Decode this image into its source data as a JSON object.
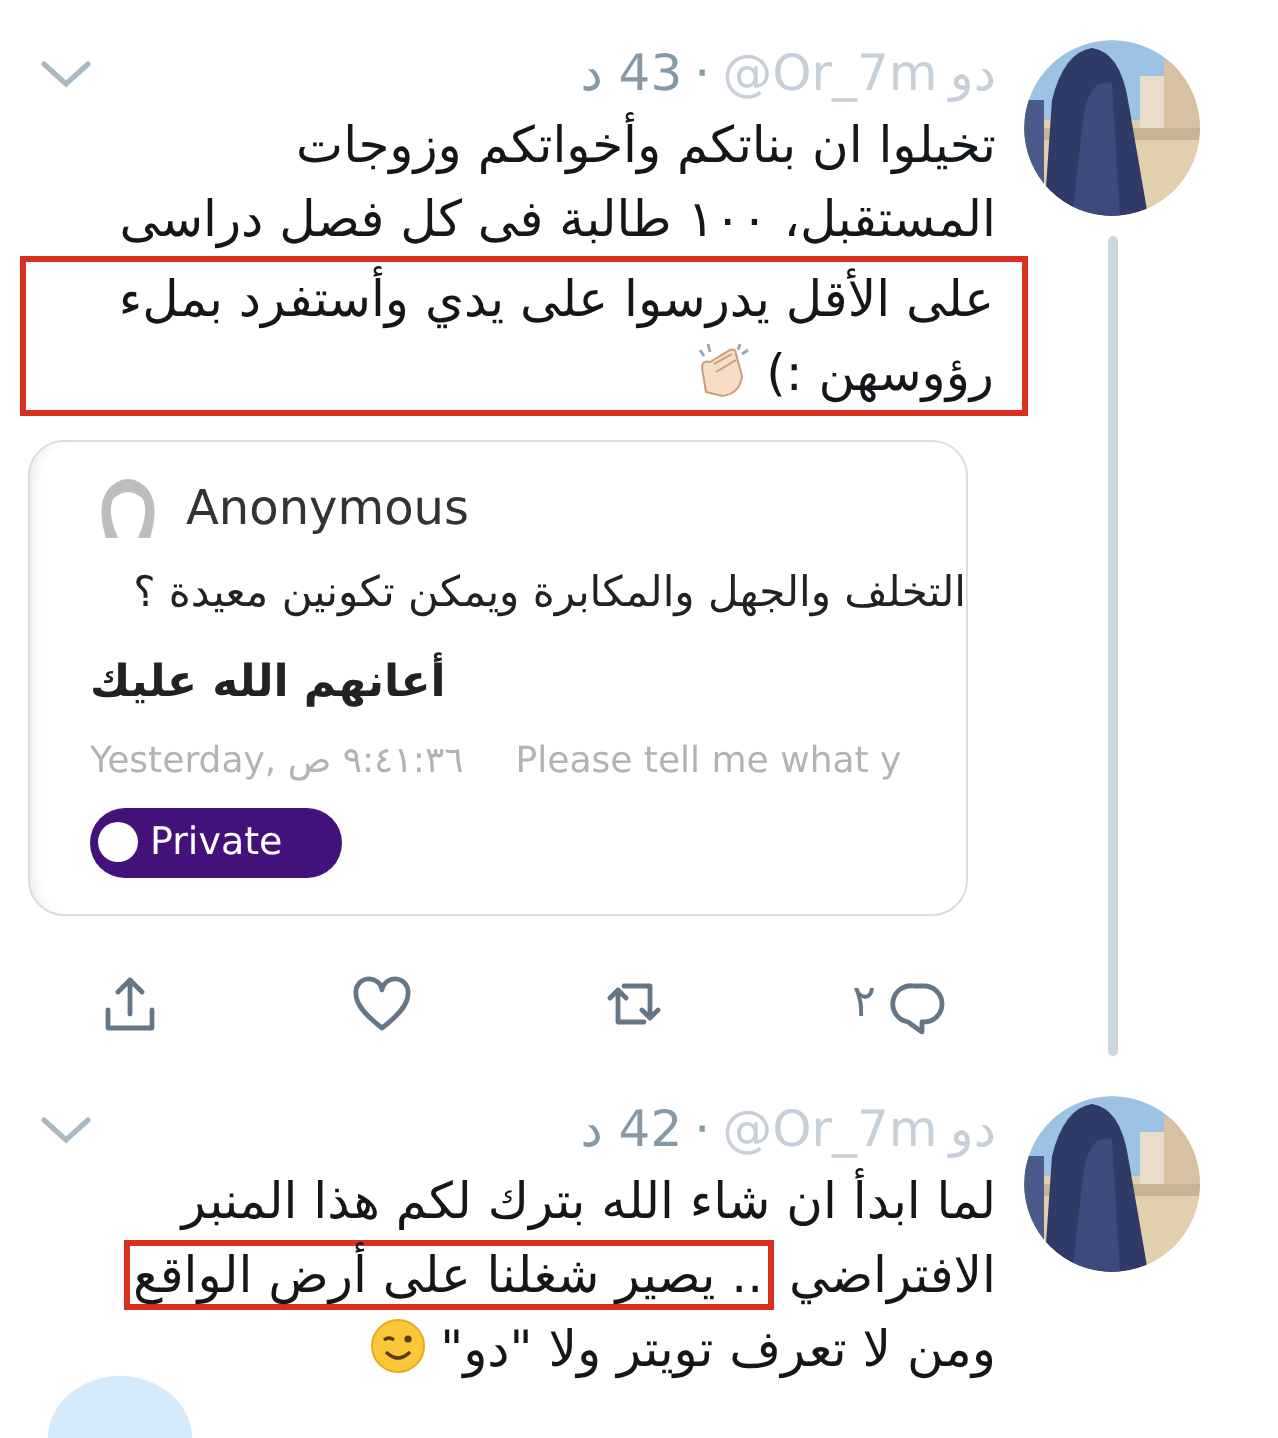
{
  "tweets": [
    {
      "name": "دو",
      "handle": "@Or_7m",
      "separator": "·",
      "time": "43 د",
      "thread_below": true,
      "text_blocks": [
        {
          "highlighted": false,
          "lines": [
            [
              {
                "kind": "text",
                "text": "تخيلوا ان بناتكم وأخواتكم وزوجات",
                "highlighted": false
              }
            ],
            [
              {
                "kind": "text",
                "text": "المستقبل، ١٠٠ طالبة فى كل فصل دراسى",
                "highlighted": false
              }
            ]
          ]
        },
        {
          "highlighted": true,
          "lines": [
            [
              {
                "kind": "text",
                "text": "على الأقل يدرسوا على يدي وأستفرد بملء",
                "highlighted": false
              }
            ],
            [
              {
                "kind": "text",
                "text": "رؤوسهن :)",
                "highlighted": false
              },
              {
                "kind": "clap-emoji"
              }
            ]
          ]
        }
      ],
      "attachment": {
        "author": "Anonymous",
        "question": "التخلف والجهل والمكابرة ويمكن تكونين معيدة ؟",
        "answer": "أعانهم الله عليك",
        "timestamp": "Yesterday, ٩:٤١:٣٦ ص",
        "note": "Please tell me what y",
        "badge": "Private"
      },
      "actions": [
        {
          "kind": "reply",
          "count": "٢"
        },
        {
          "kind": "retweet"
        },
        {
          "kind": "like"
        },
        {
          "kind": "share"
        }
      ]
    },
    {
      "name": "دو",
      "handle": "@Or_7m",
      "separator": "·",
      "time": "42 د",
      "thread_below": false,
      "text_blocks": [
        {
          "highlighted": false,
          "lines": [
            [
              {
                "kind": "text",
                "text": "لما ابدأ ان شاء الله بترك لكم هذا المنبر",
                "highlighted": false
              }
            ],
            [
              {
                "kind": "text",
                "text": "الافتراضي",
                "highlighted": false
              },
              {
                "kind": "text",
                "text": ".. يصير شغلنا على أرض الواقع",
                "highlighted": true
              }
            ],
            [
              {
                "kind": "text",
                "text": "ومن لا تعرف تويتر ولا \"دو\"",
                "highlighted": false
              },
              {
                "kind": "wink-emoji"
              }
            ]
          ]
        }
      ]
    }
  ]
}
